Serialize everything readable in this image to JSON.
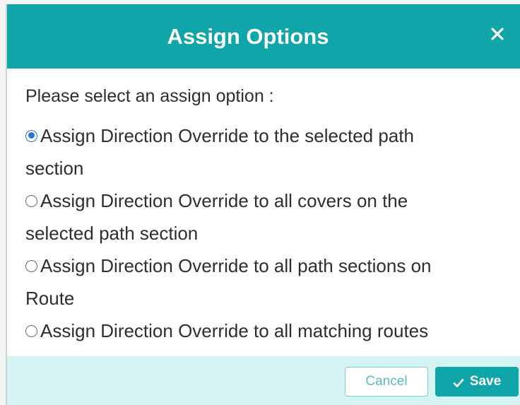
{
  "dialog": {
    "title": "Assign Options",
    "close_icon": "close-icon",
    "prompt": "Please select an assign option :",
    "selected_option": 0,
    "options": [
      {
        "text": "Assign Direction Override to the selected path section",
        "line1": "Assign Direction Override to the selected path",
        "line2": "section"
      },
      {
        "text": "Assign Direction Override to all covers on the selected path section",
        "line1": "Assign Direction Override to all covers on the",
        "line2": "selected path section"
      },
      {
        "text": "Assign Direction Override to all path sections on Route",
        "line1": "Assign Direction Override to all path sections on",
        "line2": "Route"
      },
      {
        "text": "Assign Direction Override to all matching routes",
        "line1": "Assign Direction Override to all matching routes",
        "line2": ""
      }
    ],
    "buttons": {
      "cancel_label": "Cancel",
      "save_label": "Save",
      "save_icon": "check-icon"
    }
  },
  "colors": {
    "header": "#10a5a8",
    "footer": "#d6f3f3",
    "radio_selected": "#2b6fd6"
  }
}
